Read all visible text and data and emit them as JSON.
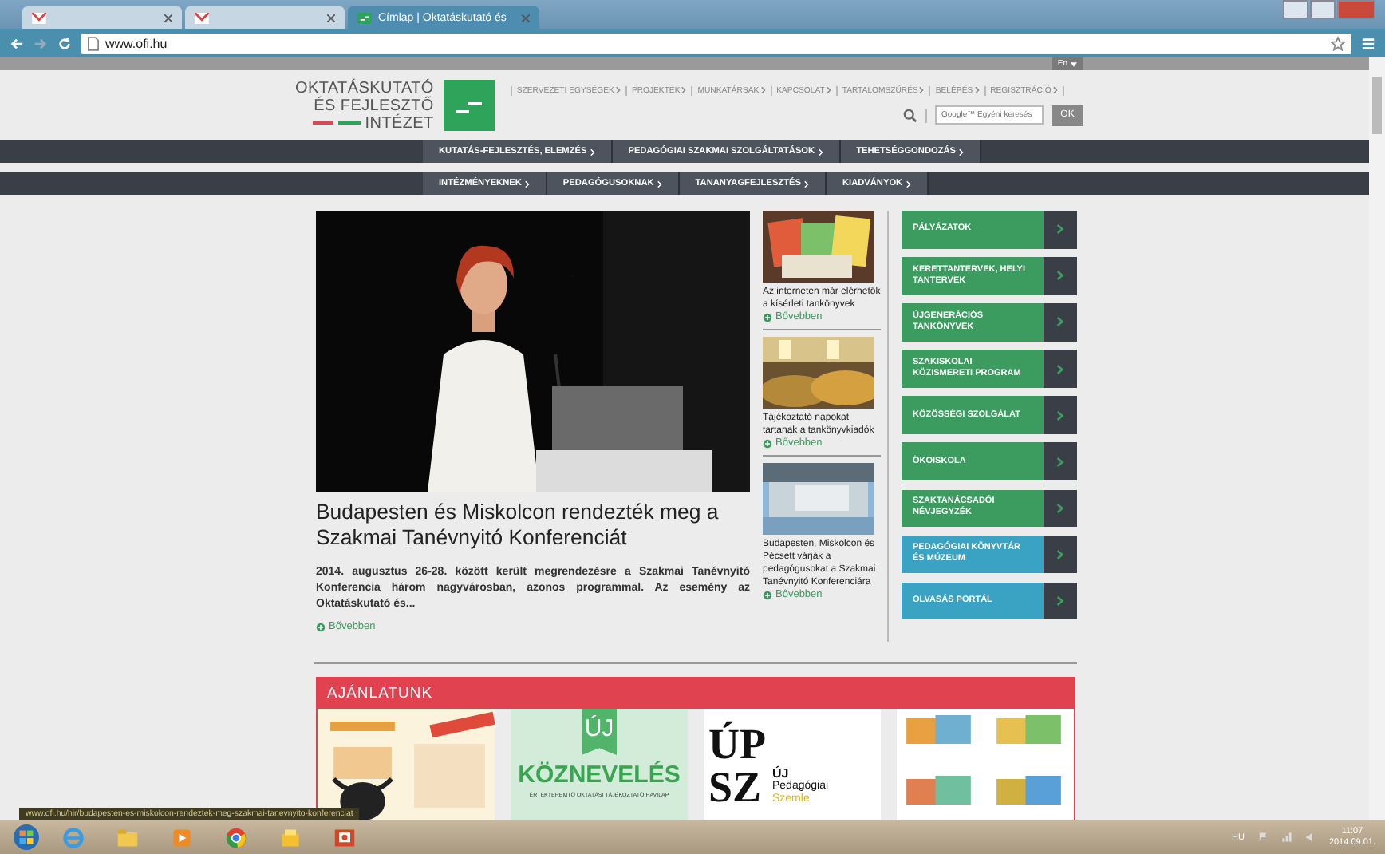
{
  "browser": {
    "tabs": [
      {
        "kind": "mail",
        "selected": false
      },
      {
        "kind": "mail",
        "selected": false
      },
      {
        "kind": "site",
        "title": "Címlap | Oktatáskutató és",
        "selected": true
      }
    ],
    "url": "www.ofi.hu"
  },
  "header": {
    "language": "En",
    "logo_lines": [
      "OKTATÁSKUTATÓ",
      "ÉS FEJLESZTŐ",
      "INTÉZET"
    ],
    "top_links": [
      "SZERVEZETI EGYSÉGEK",
      "PROJEKTEK",
      "MUNKATÁRSAK",
      "KAPCSOLAT",
      "TARTALOMSZŰRÉS",
      "BELÉPÉS",
      "REGISZTRÁCIÓ"
    ],
    "search": {
      "placeholder": "Google™ Egyéni keresés",
      "button": "OK"
    }
  },
  "nav_primary": [
    "KUTATÁS-FEJLESZTÉS, ELEMZÉS",
    "PEDAGÓGIAI SZAKMAI SZOLGÁLTATÁSOK",
    "TEHETSÉGGONDOZÁS"
  ],
  "nav_secondary": [
    "INTÉZMÉNYEKNEK",
    "PEDAGÓGUSOKNAK",
    "TANANYAGFEJLESZTÉS",
    "KIADVÁNYOK"
  ],
  "featured": {
    "headline": "Budapesten és Miskolcon rendezték meg a Szakmai Tanévnyitó Konferenciát",
    "summary": "2014. augusztus 26-28. között került megrendezésre a Szakmai Tanévnyitó Konferencia három nagyvárosban, azonos programmal. Az esemény az Oktatáskutató és...",
    "more": "Bővebben"
  },
  "news": [
    {
      "kind": "books",
      "caption": "Az interneten már elérhetők a kísérleti tankönyvek",
      "more": "Bővebben"
    },
    {
      "kind": "audience",
      "caption": "Tájékoztató napokat tartanak a tankönyvkiadók",
      "more": "Bővebben"
    },
    {
      "kind": "building",
      "caption": "Budapesten, Miskolcon és Pécsett várják a pedagógusokat a Szakmai Tanévnyitó Konferenciára",
      "more": "Bővebben"
    }
  ],
  "quick_links": [
    {
      "label": "PÁLYÁZATOK",
      "color": "#3c9b5f"
    },
    {
      "label": "KERETTANTERVEK, HELYI TANTERVEK",
      "color": "#3c9b5f"
    },
    {
      "label": "ÚJGENERÁCIÓS TANKÖNYVEK",
      "color": "#3c9b5f"
    },
    {
      "label": "SZAKISKOLAI KÖZISMERETI PROGRAM",
      "color": "#3c9b5f"
    },
    {
      "label": "KÖZÖSSÉGI SZOLGÁLAT",
      "color": "#3c9b5f"
    },
    {
      "label": "ÖKOISKOLA",
      "color": "#3c9b5f"
    },
    {
      "label": "SZAKTANÁCSADÓI NÉVJEGYZÉK",
      "color": "#3c9b5f"
    },
    {
      "label": "PEDAGÓGIAI KÖNYVTÁR ÉS MÚZEUM",
      "color": "#3aa3c4"
    },
    {
      "label": "OLVASÁS PORTÁL",
      "color": "#3aa3c4"
    }
  ],
  "offers": {
    "title": "AJÁNLATUNK",
    "tiles": [
      {
        "kind": "picture"
      },
      {
        "kind": "koznev",
        "mark": "ÚJ",
        "title": "KÖZNEVELÉS",
        "subtitle": "ÉRTÉKTEREMTŐ OKTATÁSI TÁJÉKOZTATÓ HAVILAP"
      },
      {
        "kind": "upsz",
        "big_top": "ÚP",
        "big_bottom": "SZ",
        "line1": "ÚJ",
        "line2": "Pedagógiai",
        "line3": "Szemle"
      },
      {
        "kind": "books"
      }
    ]
  },
  "status_url": "www.ofi.hu/hir/budapesten-es-miskolcon-rendeztek-meg-szakmai-tanevnyito-konferenciat",
  "taskbar": {
    "language": "HU",
    "time": "11:07",
    "date": "2014.09.01."
  }
}
